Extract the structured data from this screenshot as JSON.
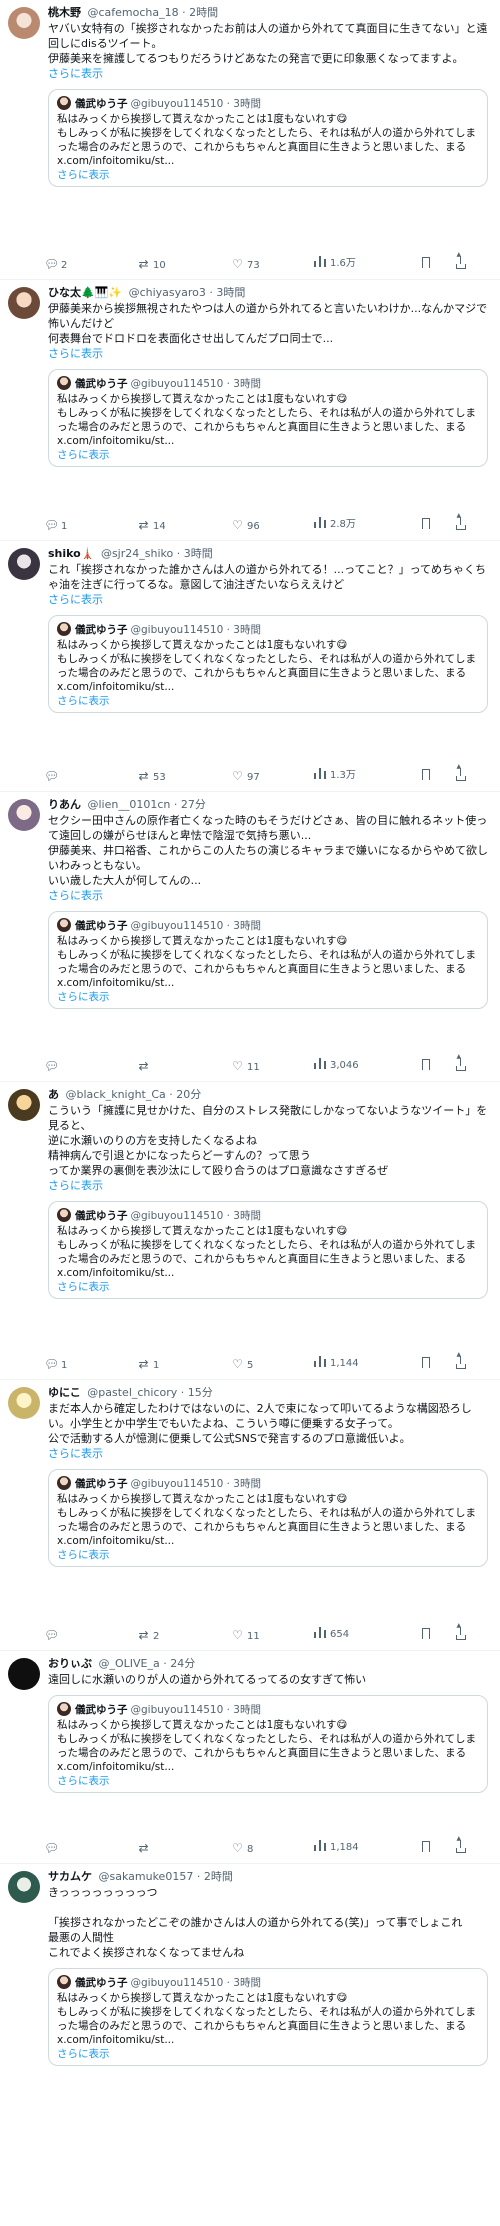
{
  "more_label": "さらに表示",
  "quoted": {
    "name": "儀武ゆう子",
    "handle": "@gibuyou114510",
    "time": "3時間",
    "text": "私はみっくから挨拶して貰えなかったことは1度もないれす😋\nもしみっくが私に挨拶をしてくれなくなったとしたら、それは私が人の道から外れてしまった場合のみだと思うので、これからもちゃんと真面目に生きようと思いました、まる x.com/infoitomiku/st..."
  },
  "tweets": [
    {
      "name": "桃木野",
      "handle": "@cafemocha_18",
      "time": "2時間",
      "text": "ヤバい女特有の「挨拶されなかったお前は人の道から外れてて真面目に生きてない」と遠回しにdisるツイート。\n伊藤美来を擁護してるつもりだろうけどあなたの発言で更に印象悪くなってますよ。",
      "replies": "2",
      "retweets": "10",
      "likes": "73",
      "views": "1.6万"
    },
    {
      "name": "ひな太🌲🎹✨",
      "handle": "@chiyasyaro3",
      "time": "3時間",
      "text": "伊藤美来から挨拶無視されたやつは人の道から外れてると言いたいわけか...なんかマジで怖いんだけど\n何表舞台でドロドロを表面化させ出してんだプロ同士で...",
      "replies": "1",
      "retweets": "14",
      "likes": "96",
      "views": "2.8万"
    },
    {
      "name": "shiko🗼",
      "handle": "@sjr24_shiko",
      "time": "3時間",
      "text": "これ「挨拶されなかった誰かさんは人の道から外れてる！...ってこと？」ってめちゃくちゃ油を注ぎに行ってるな。意図して油注ぎたいならええけど",
      "replies": "",
      "retweets": "53",
      "likes": "97",
      "views": "1.3万"
    },
    {
      "name": "りあん",
      "handle": "@lien__0101cn",
      "time": "27分",
      "text": "セクシー田中さんの原作者亡くなった時のもそうだけどさぁ、皆の目に触れるネット使って遠回しの嫌がらせほんと卑怯で陰湿で気持ち悪い...\n伊藤美来、井口裕香、これからこの人たちの演じるキャラまで嫌いになるからやめて欲しいわみっともない。\nいい歳した大人が何してんの...",
      "replies": "",
      "retweets": "",
      "likes": "11",
      "views": "3,046"
    },
    {
      "name": "あ",
      "handle": "@black_knight_Ca",
      "time": "20分",
      "text": "こういう「擁護に見せかけた、自分のストレス発散にしかなってないようなツイート」を見ると、\n逆に水瀬いのりの方を支持したくなるよね\n精神病んで引退とかになったらどーすんの？って思う\nってか業界の裏側を表沙汰にして殴り合うのはプロ意識なさすぎるぜ",
      "replies": "1",
      "retweets": "1",
      "likes": "5",
      "views": "1,144"
    },
    {
      "name": "ゆにこ",
      "handle": "@pastel_chicory",
      "time": "15分",
      "text": "まだ本人から確定したわけではないのに、2人で束になって叩いてるような構図恐ろしい。小学生とか中学生でもいたよね、こういう噂に便乗する女子って。\n公で活動する人が憶測に便乗して公式SNSで発言するのプロ意識低いよ。",
      "replies": "",
      "retweets": "2",
      "likes": "11",
      "views": "654"
    },
    {
      "name": "おりぃぶ",
      "handle": "@_OLIVE_a",
      "time": "24分",
      "text": "遠回しに水瀬いのりが人の道から外れてるってるの女すぎて怖い",
      "replies": "",
      "retweets": "",
      "likes": "8",
      "views": "1,184"
    },
    {
      "name": "サカムケ",
      "handle": "@sakamuke0157",
      "time": "2時間",
      "text": "きっっっっっっっっつ\n\n「挨拶されなかったどこぞの誰かさんは人の道から外れてる(笑)」って事でしょこれ\n最悪の人間性\nこれでよく挨拶されなくなってませんね",
      "replies": "",
      "retweets": "",
      "likes": "",
      "views": ""
    }
  ]
}
